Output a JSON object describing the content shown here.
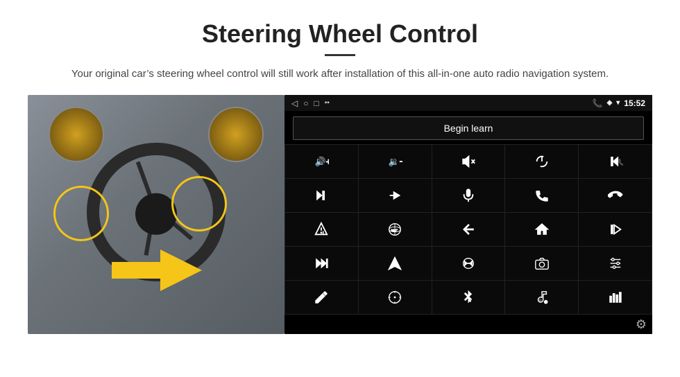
{
  "header": {
    "title": "Steering Wheel Control",
    "subtitle": "Your original car’s steering wheel control will still work after installation of this all-in-one auto radio navigation system."
  },
  "status_bar": {
    "time": "15:52",
    "nav_icons": [
      "back-arrow",
      "circle",
      "square",
      "signal"
    ]
  },
  "begin_learn_btn": "Begin learn",
  "controls": [
    {
      "id": "vol-up",
      "label": "Volume Up",
      "icon": "vol_up"
    },
    {
      "id": "vol-down",
      "label": "Volume Down",
      "icon": "vol_down"
    },
    {
      "id": "mute",
      "label": "Mute",
      "icon": "mute"
    },
    {
      "id": "power",
      "label": "Power",
      "icon": "power"
    },
    {
      "id": "prev-track",
      "label": "Previous Track",
      "icon": "prev_track"
    },
    {
      "id": "skip-next",
      "label": "Skip Next",
      "icon": "skip_next"
    },
    {
      "id": "fast-forward",
      "label": "Fast Forward",
      "icon": "fast_fwd"
    },
    {
      "id": "mic",
      "label": "Microphone",
      "icon": "mic"
    },
    {
      "id": "phone",
      "label": "Phone",
      "icon": "phone"
    },
    {
      "id": "hang-up",
      "label": "Hang Up",
      "icon": "hang_up"
    },
    {
      "id": "alert",
      "label": "Alert",
      "icon": "alert"
    },
    {
      "id": "360-view",
      "label": "360 View",
      "icon": "view360"
    },
    {
      "id": "back",
      "label": "Back",
      "icon": "back"
    },
    {
      "id": "home",
      "label": "Home",
      "icon": "home"
    },
    {
      "id": "skip-prev",
      "label": "Skip Previous",
      "icon": "skip_prev"
    },
    {
      "id": "ff2",
      "label": "Fast Forward 2",
      "icon": "ff2"
    },
    {
      "id": "navigate",
      "label": "Navigate",
      "icon": "navigate"
    },
    {
      "id": "eq",
      "label": "Equalizer",
      "icon": "eq"
    },
    {
      "id": "camera",
      "label": "Camera",
      "icon": "camera"
    },
    {
      "id": "settings2",
      "label": "Settings 2",
      "icon": "settings2"
    },
    {
      "id": "edit",
      "label": "Edit",
      "icon": "edit"
    },
    {
      "id": "target",
      "label": "Target",
      "icon": "target"
    },
    {
      "id": "bluetooth",
      "label": "Bluetooth",
      "icon": "bluetooth"
    },
    {
      "id": "music",
      "label": "Music",
      "icon": "music"
    },
    {
      "id": "equalizer",
      "label": "Equalizer Bars",
      "icon": "eq_bars"
    }
  ],
  "settings_icon": "gear",
  "colors": {
    "screen_bg": "#000000",
    "cell_bg": "#0a0a0a",
    "grid_gap": "#222222",
    "btn_border": "#555555",
    "icon_color": "#ffffff",
    "status_bg": "#111111"
  }
}
